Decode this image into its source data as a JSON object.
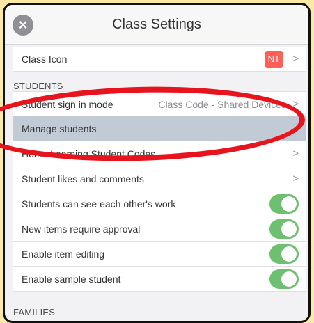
{
  "header": {
    "title": "Class Settings",
    "close_icon": "close-icon"
  },
  "rows": {
    "class_icon": {
      "label": "Class Icon",
      "badge": "NT",
      "chevron": ">"
    },
    "sign_in": {
      "label": "Student sign in mode",
      "value": "Class Code - Shared Devices",
      "chevron": ">"
    },
    "manage": {
      "label": "Manage students"
    },
    "home_codes": {
      "label": "Home Learning Student Codes",
      "chevron": ">"
    },
    "likes": {
      "label": "Student likes and comments",
      "chevron": ">"
    },
    "see_work": {
      "label": "Students can see each other's work",
      "on": true
    },
    "approval": {
      "label": "New items require approval",
      "on": true
    },
    "editing": {
      "label": "Enable item editing",
      "on": true
    },
    "sample": {
      "label": "Enable sample student",
      "on": true
    }
  },
  "sections": {
    "students": "STUDENTS",
    "families": "FAMILIES"
  },
  "colors": {
    "toggle_on": "#6dc06f",
    "highlight": "#e8141d",
    "badge": "#ff5f56",
    "selected_row": "#c2cad5",
    "background": "#fde9a6"
  }
}
